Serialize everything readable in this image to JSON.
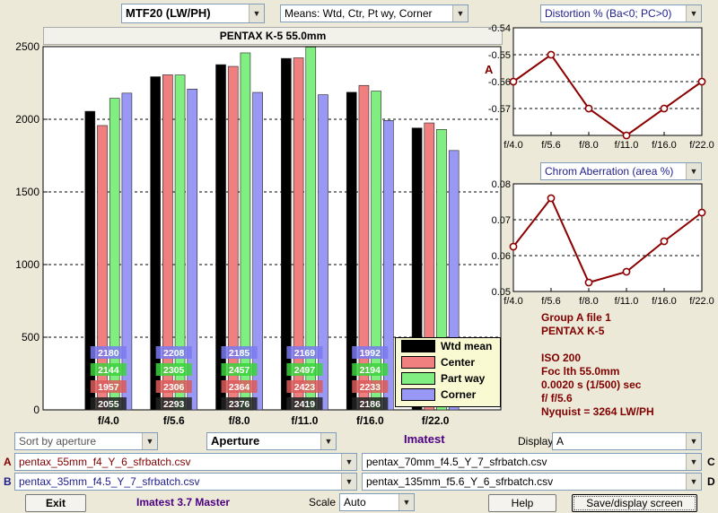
{
  "top": {
    "metric": "MTF20 (LW/PH)",
    "means": "Means: Wtd, Ctr, Pt wy, Corner",
    "title": "PENTAX K-5    55.0mm"
  },
  "colors": {
    "wtd": "#000000",
    "center": "#f08080",
    "partway": "#80ee80",
    "corner": "#9999f5",
    "line": "#8b0000",
    "darkred": "#800000",
    "navy": "#1e1e8c",
    "purple": "#4b0082"
  },
  "chart_data": [
    {
      "type": "bar",
      "categories": [
        "f/4.0",
        "f/5.6",
        "f/8.0",
        "f/11.0",
        "f/16.0",
        "f/22.0"
      ],
      "series": [
        {
          "name": "Wtd mean",
          "values": [
            2055,
            2293,
            2376,
            2419,
            2186,
            1940
          ]
        },
        {
          "name": "Center",
          "values": [
            1957,
            2306,
            2364,
            2423,
            2233,
            1975
          ]
        },
        {
          "name": "Part way",
          "values": [
            2144,
            2305,
            2457,
            2497,
            2194,
            1930
          ]
        },
        {
          "name": "Corner",
          "values": [
            2180,
            2208,
            2185,
            2169,
            1992,
            1785
          ]
        }
      ],
      "labeled_bars": 5,
      "ylim": [
        0,
        2500
      ],
      "yticks": [
        "0",
        "500",
        "1000",
        "1500",
        "2000",
        "2500"
      ],
      "annotation": "A",
      "legend_position": "bottom-right",
      "grid": true
    },
    {
      "type": "line",
      "title": "Distortion %  (Ba<0; PC>0)",
      "x": [
        "f/4.0",
        "f/5.6",
        "f/8.0",
        "f/11.0",
        "f/16.0",
        "f/22.0"
      ],
      "values": [
        -0.56,
        -0.55,
        -0.57,
        -0.58,
        -0.57,
        -0.56
      ],
      "ylim": [
        -0.58,
        -0.54
      ],
      "yticks": [
        "-0.54",
        "-0.55",
        "-0.56",
        "-0.57"
      ]
    },
    {
      "type": "line",
      "title": "Chrom Aberration (area %)",
      "x": [
        "f/4.0",
        "f/5.6",
        "f/8.0",
        "f/11.0",
        "f/16.0",
        "f/22.0"
      ],
      "values": [
        0.0625,
        0.076,
        0.0525,
        0.0555,
        0.064,
        0.072
      ],
      "ylim": [
        0.05,
        0.08
      ],
      "yticks": [
        "0.08",
        "0.07",
        "0.06",
        "0.05"
      ]
    }
  ],
  "info": {
    "line1": "Group A file 1",
    "line2": "PENTAX K-5",
    "line3": "ISO  200",
    "line4": "Foc lth  55.0mm",
    "line5": "0.0020 s  (1/500)  sec",
    "line6": "f/  f/5.6",
    "line7": "Nyquist = 3264 LW/PH"
  },
  "controls": {
    "sort": "Sort by aperture",
    "aperture": "Aperture",
    "imatest": "Imatest",
    "display_label": "Display",
    "display_value": "A",
    "file_a_label": "A",
    "file_a": "pentax_55mm_f4_Y_6_sfrbatch.csv",
    "file_b_label": "B",
    "file_b": "pentax_35mm_f4.5_Y_7_sfrbatch.csv",
    "file_c_label": "C",
    "file_c": "pentax_70mm_f4.5_Y_7_sfrbatch.csv",
    "file_d_label": "D",
    "file_d": "pentax_135mm_f5.6_Y_6_sfrbatch.csv",
    "exit": "Exit",
    "version": "Imatest 3.7 Master",
    "scale_label": "Scale",
    "scale_value": "Auto",
    "help": "Help",
    "save": "Save/display screen"
  },
  "icons": {
    "dropdown": "triangle-down-icon"
  }
}
